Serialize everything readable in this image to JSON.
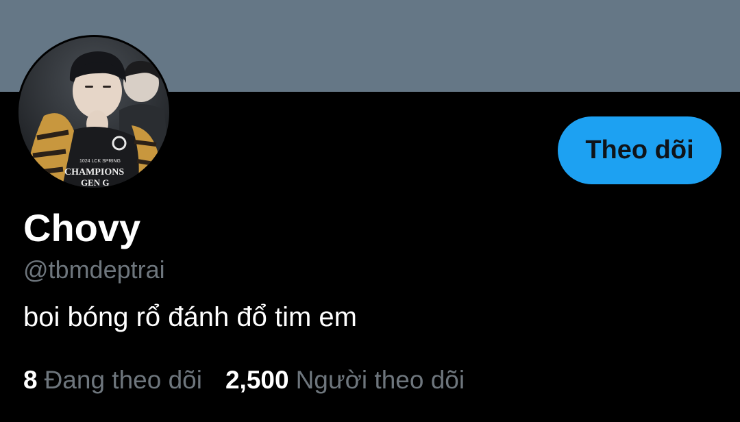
{
  "colors": {
    "banner": "#657786",
    "background": "#000000",
    "accent": "#1da1f2",
    "muted_text": "#6e767d",
    "primary_text": "#ffffff"
  },
  "profile": {
    "avatar_icon": "profile-photo",
    "avatar_text_lines": [
      "1024 LCK SPRING",
      "CHAMPIONS",
      "GEN G"
    ],
    "display_name": "Chovy",
    "handle": "@tbmdeptrai",
    "bio": "boi bóng rổ đánh đổ tim em",
    "follow_label": "Theo dõi"
  },
  "stats": {
    "following_count": "8",
    "following_label": "Đang theo dõi",
    "followers_count": "2,500",
    "followers_label": "Người theo dõi"
  }
}
